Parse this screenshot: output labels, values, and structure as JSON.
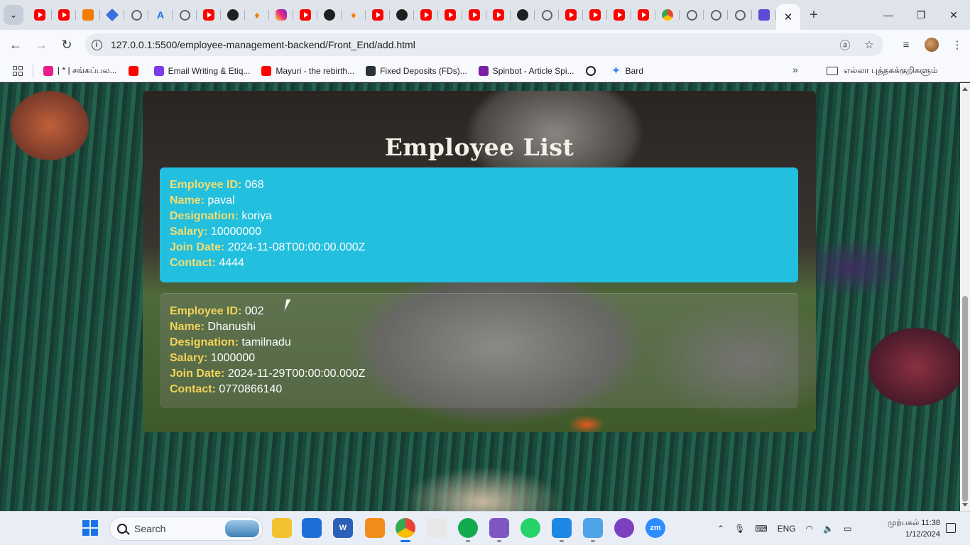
{
  "browser": {
    "tab_favicons": [
      "youtube-icon",
      "youtube-icon",
      "sc-icon",
      "diamond-icon",
      "globe-icon",
      "azure-icon",
      "openai-icon",
      "youtube-icon",
      "dark-icon",
      "fire-icon",
      "instagram-icon",
      "youtube-icon",
      "github-icon",
      "fire-icon",
      "youtube-icon",
      "github-icon",
      "youtube-icon",
      "youtube-icon",
      "youtube-icon",
      "youtube-icon",
      "github-icon",
      "globe-icon",
      "youtube-icon",
      "youtube-icon",
      "youtube-icon",
      "youtube-icon",
      "chrome-icon",
      "globe-icon",
      "globe-icon",
      "globe-icon",
      "sheet-icon"
    ],
    "url": "127.0.0.1:5500/employee-management-backend/Front_End/add.html",
    "bookmarks": [
      {
        "label": "| * | சங்கப்பல...",
        "icon": "bookmark-page-icon",
        "color": "#e91e8c"
      },
      {
        "label": "",
        "icon": "youtube-icon",
        "color": "#ff0000"
      },
      {
        "label": "Email Writing & Etiq...",
        "icon": "bookmark-u-icon",
        "color": "#7c3aed"
      },
      {
        "label": "Mayuri - the rebirth...",
        "icon": "youtube-icon",
        "color": "#ff0000"
      },
      {
        "label": "Fixed Deposits (FDs)...",
        "icon": "bookmark-ab-icon",
        "color": "#263238"
      },
      {
        "label": "Spinbot - Article Spi...",
        "icon": "spinbot-icon",
        "color": "#7b1fa2"
      },
      {
        "label": "",
        "icon": "globe-icon",
        "color": "#1f1f1f"
      },
      {
        "label": "Bard",
        "icon": "bard-icon",
        "color": "#4285f4"
      }
    ],
    "bookmarks_folder": "எல்லா புத்தகக்குறிகளும்"
  },
  "page": {
    "title": "Employee List",
    "labels": {
      "id": "Employee ID:",
      "name": "Name:",
      "designation": "Designation:",
      "salary": "Salary:",
      "join_date": "Join Date:",
      "contact": "Contact:"
    },
    "employees": [
      {
        "id": "068",
        "name": "paval",
        "designation": "koriya",
        "salary": "10000000",
        "join_date": "2024-11-08T00:00:00.000Z",
        "contact": "4444"
      },
      {
        "id": "002",
        "name": "Dhanushi",
        "designation": "tamilnadu",
        "salary": "1000000",
        "join_date": "2024-11-29T00:00:00.000Z",
        "contact": "0770866140"
      }
    ],
    "colors": {
      "card_active": "#22bfde",
      "label": "#f3d35a",
      "title": "#f4f0ea"
    }
  },
  "taskbar": {
    "search_placeholder": "Search",
    "apps": [
      "file-explorer-icon",
      "store-icon",
      "word-icon",
      "vlc-icon",
      "chrome-icon",
      "powerpoint-icon",
      "mongodb-icon",
      "visual-studio-icon",
      "whatsapp-icon",
      "vscode-icon",
      "azure-data-icon",
      "github-desktop-icon",
      "zoom-icon"
    ],
    "language": "ENG",
    "time": "முற்பகல் 11:38",
    "date": "1/12/2024"
  }
}
